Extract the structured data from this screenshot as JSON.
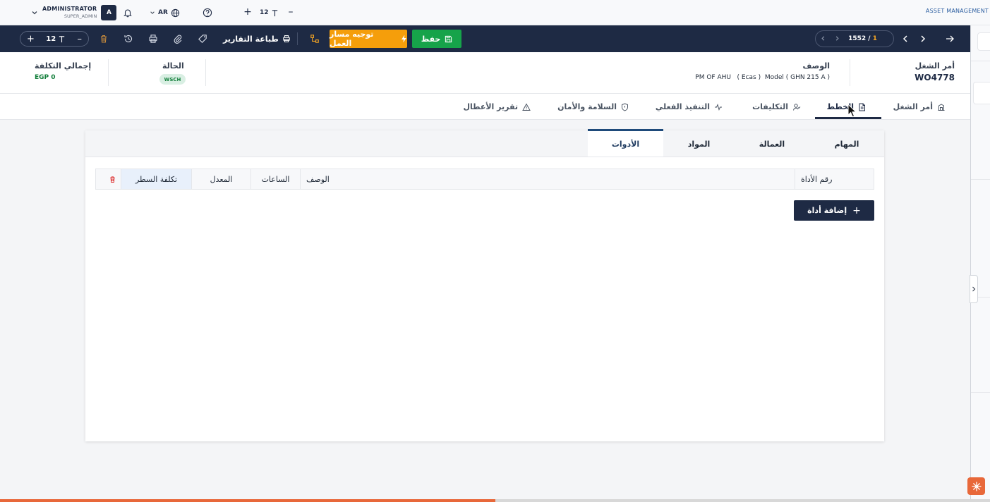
{
  "topbar": {
    "user_name": "ADMINISTRATOR",
    "user_role": "SUPER_ADMIN",
    "avatar_letter": "A",
    "language": "AR",
    "font_size": "12",
    "brand": "ASSET MANAGEMENT"
  },
  "toolbar": {
    "font_size": "12",
    "print_reports_label": "طباعة التقارير",
    "route_label": "توجيه مسار العمل",
    "save_label": "حفظ",
    "pager_total": "1552",
    "pager_sep": "/",
    "pager_current": "1"
  },
  "header": {
    "wo_label": "أمر الشغل",
    "wo_value": "WO4778",
    "desc_label": "الوصف",
    "desc_value": "PM OF AHU   ( Ecas )  Model ( GHN 215 A )",
    "status_label": "الحالة",
    "status_value": "WSCH",
    "cost_label": "إجمالي التكلفة",
    "cost_value": "EGP 0"
  },
  "tabs": [
    {
      "label": "أمر الشغل"
    },
    {
      "label": "الخطط"
    },
    {
      "label": "التكليفات"
    },
    {
      "label": "التنفيذ الفعلي"
    },
    {
      "label": "السلامة والأمان"
    },
    {
      "label": "تقرير الأعطال"
    }
  ],
  "subtabs": [
    {
      "label": "المهام"
    },
    {
      "label": "العمالة"
    },
    {
      "label": "المواد"
    },
    {
      "label": "الأدوات"
    }
  ],
  "table": {
    "columns": [
      "رقم الأداة",
      "الوصف",
      "الساعات",
      "المعدل",
      "تكلفة السطر"
    ]
  },
  "add_tool_label": "إضافة أداة",
  "page_load_progress": 0.5,
  "colors": {
    "navy": "#1e2a44",
    "save_green": "#16a34a",
    "route_orange": "#f59e0b",
    "status_green": "#15803d",
    "progress_orange": "#e8683a"
  }
}
